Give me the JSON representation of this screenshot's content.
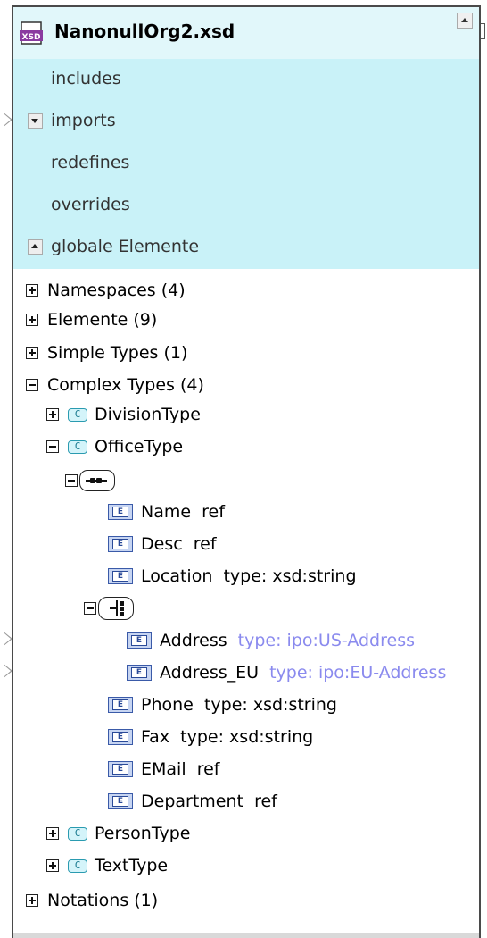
{
  "schema": {
    "title": "NanonullOrg2.xsd",
    "icon": "xsd-file-icon",
    "icon_text": "XSD"
  },
  "sections": {
    "includes": "includes",
    "imports": "imports",
    "redefines": "redefines",
    "overrides": "overrides",
    "global_elements": "globale Elemente"
  },
  "tree": {
    "namespaces": "Namespaces (4)",
    "elements": "Elemente (9)",
    "simple_types": "Simple Types (1)",
    "complex_types": "Complex Types (4)",
    "division_type": "DivisionType",
    "office_type": "OfficeType",
    "office_elements": [
      {
        "name": "Name",
        "info": "ref"
      },
      {
        "name": "Desc",
        "info": "ref"
      },
      {
        "name": "Location",
        "info": "type: xsd:string"
      }
    ],
    "choice_elements": [
      {
        "name": "Address",
        "info": "type: ipo:US-Address"
      },
      {
        "name": "Address_EU",
        "info": "type: ipo:EU-Address"
      }
    ],
    "office_elements_2": [
      {
        "name": "Phone",
        "info": "type: xsd:string"
      },
      {
        "name": "Fax",
        "info": "type: xsd:string"
      },
      {
        "name": "EMail",
        "info": "ref"
      },
      {
        "name": "Department",
        "info": "ref"
      }
    ],
    "person_type": "PersonType",
    "text_type": "TextType",
    "notations": "Notations (1)"
  },
  "icon_labels": {
    "complex_type": "C",
    "element": "E"
  },
  "colors": {
    "header_bg": "#e1f7fa",
    "section_bg": "#c9f2f8",
    "type_ref_color": "#8a8aee"
  }
}
